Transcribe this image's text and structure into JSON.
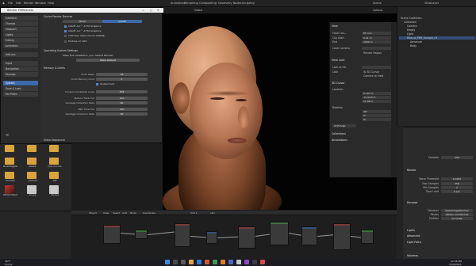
{
  "app": {
    "top_menu": [
      "File",
      "Edit",
      "Render",
      "Window",
      "Help"
    ],
    "workspaces": [
      "Layout",
      "Modeling",
      "Sculpting",
      "UV Editing",
      "Texture Paint",
      "Shading",
      "Animation",
      "Rendering",
      "Compositing",
      "Geometry Nodes",
      "Scripting"
    ],
    "scene_label": "Scene",
    "view_layer_label": "ViewLayer"
  },
  "viewport": {
    "header_items": [
      "Object Mode",
      "View",
      "Select",
      "Add",
      "Object",
      "Global"
    ],
    "options_label": "Options"
  },
  "npanel": {
    "view_heading": "View",
    "focal_length_label": "Focal Len...",
    "focal_length_value": "85 mm",
    "clip_start_label": "Clip Start",
    "clip_start_value": "0.01 m",
    "clip_end_label": "End",
    "clip_end_value": "1000 m",
    "local_camera_label": "Local Camera",
    "render_region_label": "Render Region",
    "view_lock_heading": "View Lock",
    "lock_to_object_label": "Lock to Ob",
    "lock_label": "Lock",
    "to_3d_cursor_label": "To 3D Cursor",
    "camera_to_view_label": "Camera to View",
    "cursor_heading": "3D Cursor",
    "location_label": "Location",
    "loc_x": "0.107 m",
    "loc_y": "-0.1213 m",
    "loc_z": "11.96 m",
    "rotation_label": "Rotation",
    "rot_x": "90°",
    "rot_y": "0°",
    "rot_z": "0°",
    "rotation_mode": "XYZ Euler",
    "collections_heading": "Collections",
    "annotations_heading": "Annotations"
  },
  "outliner": {
    "items": [
      "Scene Collection",
      "Collection",
      "Camera",
      "Empty",
      "Light",
      "Marcus_PBR_Sample_01",
      "Armature",
      "Body"
    ]
  },
  "properties": {
    "samples_label": "Samples",
    "samples_value": "256",
    "render_heading": "Render",
    "noise_threshold_label": "Noise Threshold",
    "noise_threshold_value": "0.0100",
    "max_samples_label": "Max Samples",
    "max_samples_value": "256",
    "min_samples_label": "Min Samples",
    "min_samples_value": "0",
    "time_limit_label": "Time Limit",
    "time_limit_value": "0 sec",
    "denoise_heading": "Denoise",
    "denoiser_label": "Denoiser",
    "denoiser_value": "OpenImageDenoise",
    "passes_label": "Passes",
    "passes_value": "Albedo and Normal",
    "prefilter_label": "Prefilter",
    "prefilter_value": "Accurate",
    "sections": [
      "Lights",
      "Advanced",
      "Light Paths",
      "Volumes"
    ]
  },
  "preferences": {
    "window_title": "Blender Preferences",
    "tabs": [
      "Interface",
      "Themes",
      "Viewport",
      "Lights",
      "Editing",
      "Animation",
      "Add-ons",
      "Input",
      "Navigation",
      "Keymap",
      "System",
      "Save & Load",
      "File Paths"
    ],
    "active_tab": "System",
    "cycles_heading": "Cycles Render Devices",
    "device_tabs": [
      "None",
      "oneAPI"
    ],
    "devices": [
      "Intel® Arc™ A770 Graphics",
      "Intel® Arc™ A770 Graphics",
      "12th Gen Intel Core i9-12900K"
    ],
    "embree_label": "Embree on GPU",
    "os_settings_heading": "Operating System Settings",
    "os_settings_text": "Make this installation your default Blender",
    "make_default_button": "Make Default",
    "memory_heading": "Memory & Limits",
    "undo_steps_label": "Undo Steps",
    "undo_steps_value": "32",
    "undo_memory_label": "Undo Memory Limit",
    "undo_memory_value": "0",
    "global_undo_label": "Global Undo",
    "console_scrollback_label": "Console Scrollback Lines",
    "console_scrollback_value": "256",
    "texture_timeout_label": "Texture Time Out",
    "texture_timeout_value": "120",
    "garbage_rate_label": "Garbage Collection Rate",
    "garbage_rate_value": "60",
    "vbo_timeout_label": "VBO Time Out",
    "vbo_timeout_value": "120",
    "vbo_garbage_label": "Garbage Collection Rate",
    "vbo_garbage_value": "60",
    "video_sequencer_heading": "Video Sequencer"
  },
  "file_browser": {
    "items": [
      {
        "name": "",
        "kind": "folder"
      },
      {
        "name": "",
        "kind": "folder"
      },
      {
        "name": "",
        "kind": "folder"
      },
      {
        "name": "Model Register...",
        "kind": "folder"
      },
      {
        "name": "RIGIDK",
        "kind": "folder"
      },
      {
        "name": "tyce-m-rrima",
        "kind": "folder"
      },
      {
        "name": "source01",
        "kind": "folder"
      },
      {
        "name": "surface0",
        "kind": "folder"
      },
      {
        "name": "ICM",
        "kind": "folder"
      },
      {
        "name": "Witcher3Hair0...",
        "kind": "image"
      },
      {
        "name": "arc.jpg",
        "kind": "file"
      },
      {
        "name": "bar.png",
        "kind": "file"
      }
    ]
  },
  "node_editor": {
    "header_items": [
      "Object",
      "View",
      "Select",
      "Add",
      "Node",
      "Use Nodes",
      "Slot 1",
      "skin"
    ],
    "tab_label": "Marcus_PBR_Sample_01"
  },
  "statusbar": {
    "weather_temp": "36°F",
    "weather_desc": "Sunny",
    "clock_time": "12:36 PM",
    "clock_date": "3/30/2023"
  }
}
